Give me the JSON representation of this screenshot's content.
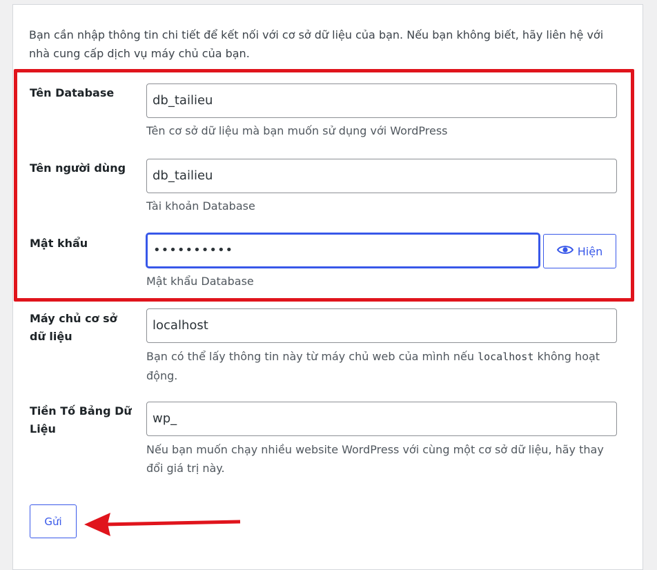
{
  "intro": "Bạn cần nhập thông tin chi tiết để kết nối với cơ sở dữ liệu của bạn. Nếu bạn không biết, hãy liên hệ với nhà cung cấp dịch vụ máy chủ của bạn.",
  "fields": {
    "dbname": {
      "label": "Tên Database",
      "value": "db_tailieu",
      "desc": "Tên cơ sở dữ liệu mà bạn muốn sử dụng với WordPress"
    },
    "username": {
      "label": "Tên người dùng",
      "value": "db_tailieu",
      "desc": "Tài khoản Database"
    },
    "password": {
      "label": "Mật khẩu",
      "value": "••••••••••",
      "desc": "Mật khẩu Database",
      "show_label": "Hiện"
    },
    "host": {
      "label": "Máy chủ cơ sở dữ liệu",
      "value": "localhost",
      "desc_before": "Bạn có thể lấy thông tin này từ máy chủ web của mình nếu",
      "desc_code": "localhost",
      "desc_after": "không hoạt động."
    },
    "prefix": {
      "label": "Tiền Tố Bảng Dữ Liệu",
      "value": "wp_",
      "desc": "Nếu bạn muốn chạy nhiều website WordPress với cùng một cơ sở dữ liệu, hãy thay đổi giá trị này."
    }
  },
  "submit_label": "Gửi",
  "colors": {
    "accent": "#3858e9",
    "annotation": "#e0141c"
  },
  "icons": {
    "show_password": "eye-icon"
  }
}
